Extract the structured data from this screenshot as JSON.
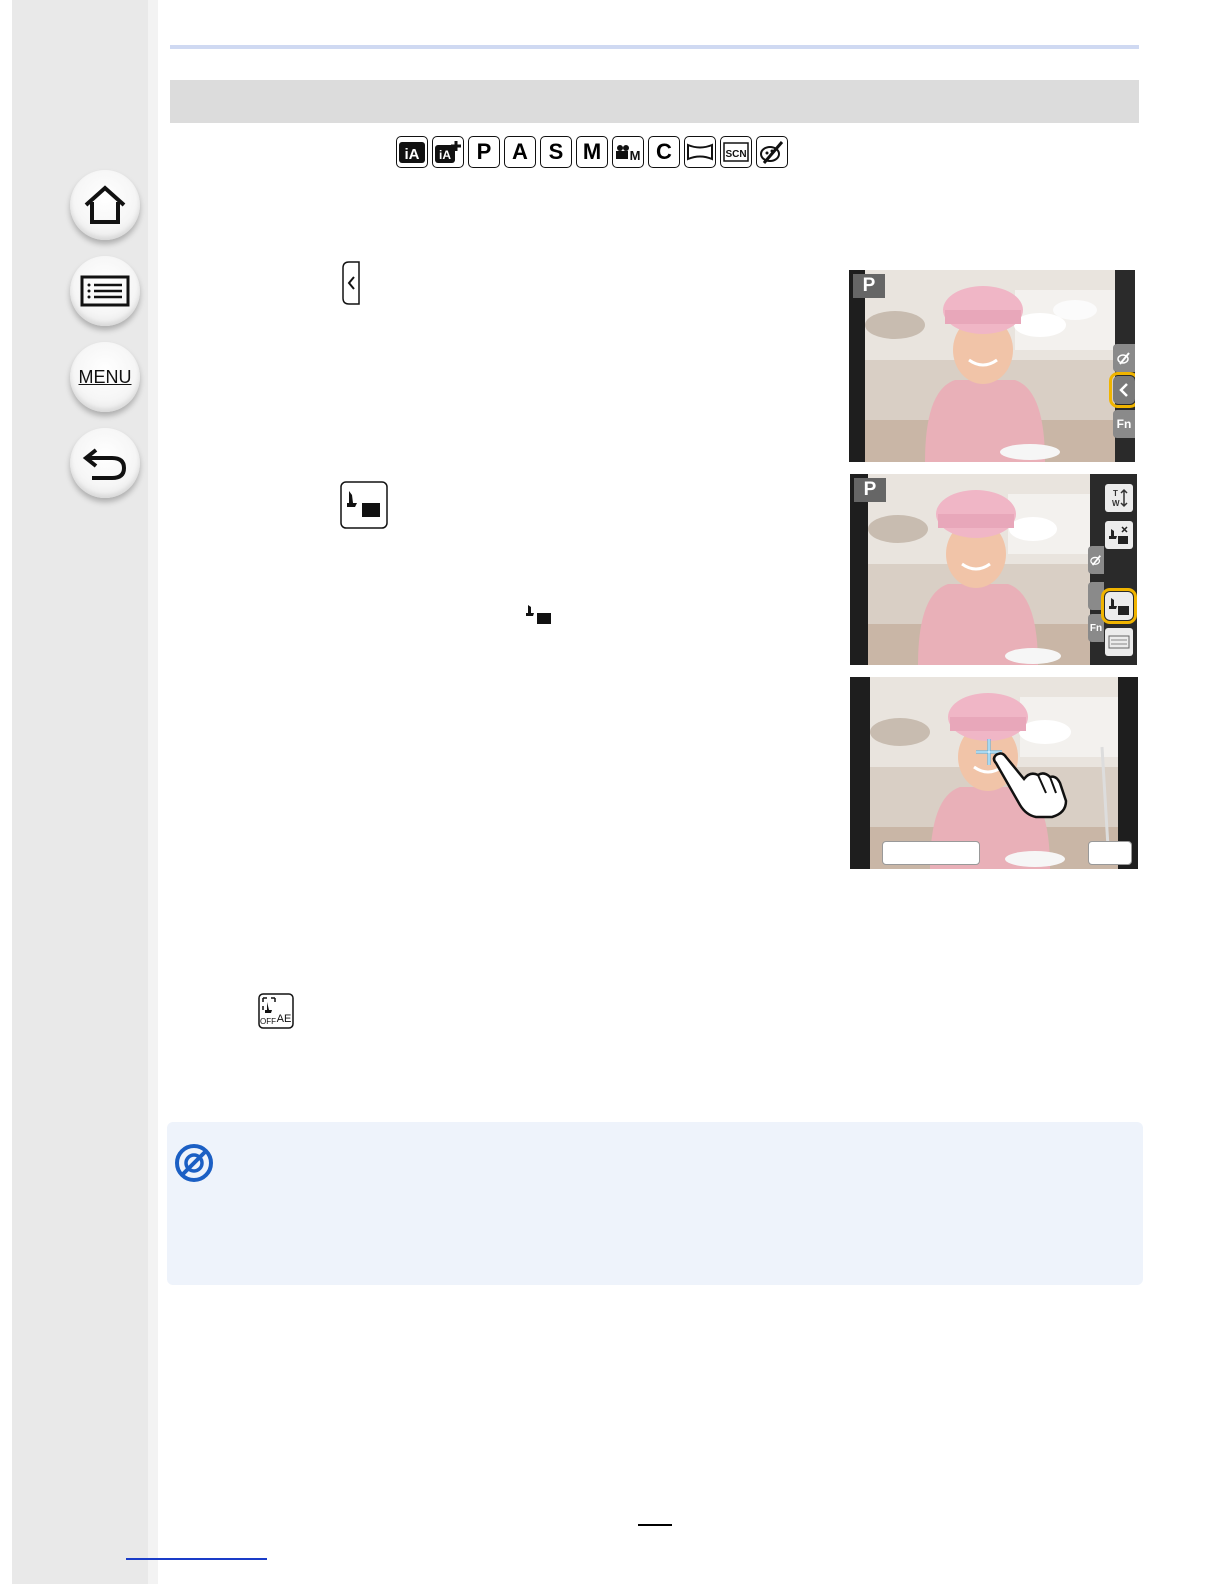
{
  "sidebar": {
    "home_icon": "home-icon",
    "contents_icon": "list-icon",
    "menu_label": "MENU",
    "back_icon": "back-arrow-icon"
  },
  "mode_icons": [
    {
      "name": "intelligent-auto-icon",
      "label": "iA"
    },
    {
      "name": "intelligent-auto-plus-icon",
      "label": "iA+"
    },
    {
      "name": "program-mode-icon",
      "label": "P"
    },
    {
      "name": "aperture-priority-icon",
      "label": "A"
    },
    {
      "name": "shutter-priority-icon",
      "label": "S"
    },
    {
      "name": "manual-mode-icon",
      "label": "M"
    },
    {
      "name": "creative-video-icon",
      "label": "M"
    },
    {
      "name": "custom-mode-icon",
      "label": "C"
    },
    {
      "name": "panorama-icon",
      "label": ""
    },
    {
      "name": "scene-guide-icon",
      "label": "SCN"
    },
    {
      "name": "creative-control-icon",
      "label": ""
    }
  ],
  "screens": {
    "screen1": {
      "mode_badge": "P",
      "tabs": [
        "",
        "<",
        "Fn"
      ]
    },
    "screen2": {
      "mode_badge": "P",
      "tabs": [
        "",
        "",
        "Fn"
      ],
      "tools": [
        "T W",
        "",
        "",
        ""
      ]
    },
    "screen3": {}
  },
  "icons": {
    "tab_open": "tab-left-arrow-icon",
    "touch_ae": "touch-ae-icon",
    "touch_ae_inline": "touch-ae-small-icon",
    "touch_ae_off": "touch-ae-off-icon",
    "touch_ae_off_text": "OFF",
    "touch_ae_off_ae": "AE",
    "note": "no-sign-icon"
  },
  "colors": {
    "highlight": "#f0b400",
    "note_bg": "#eef3fb",
    "note_icon": "#1b5fc4",
    "top_rule": "#cfd9f2"
  }
}
